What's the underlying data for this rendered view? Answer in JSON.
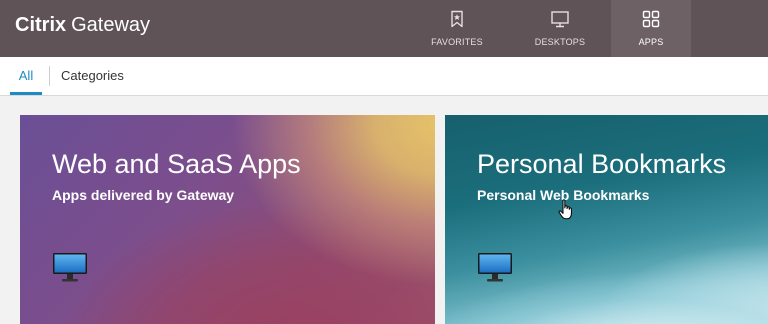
{
  "header": {
    "brand_bold": "Citrix",
    "brand_light": "Gateway",
    "nav": [
      {
        "label": "FAVORITES",
        "icon": "bookmark-icon"
      },
      {
        "label": "DESKTOPS",
        "icon": "monitor-icon"
      },
      {
        "label": "APPS",
        "icon": "grid-icon",
        "active": true
      }
    ]
  },
  "tabs": [
    {
      "label": "All",
      "active": true
    },
    {
      "label": "Categories"
    }
  ],
  "tiles": [
    {
      "title": "Web and SaaS Apps",
      "subtitle": "Apps delivered by Gateway",
      "icon": "monitor-icon"
    },
    {
      "title": "Personal Bookmarks",
      "subtitle": "Personal Web Bookmarks",
      "icon": "monitor-icon"
    }
  ],
  "colors": {
    "header_bg": "#5f5358",
    "active_nav_bg": "#6d6166",
    "accent": "#1e8bc3"
  }
}
